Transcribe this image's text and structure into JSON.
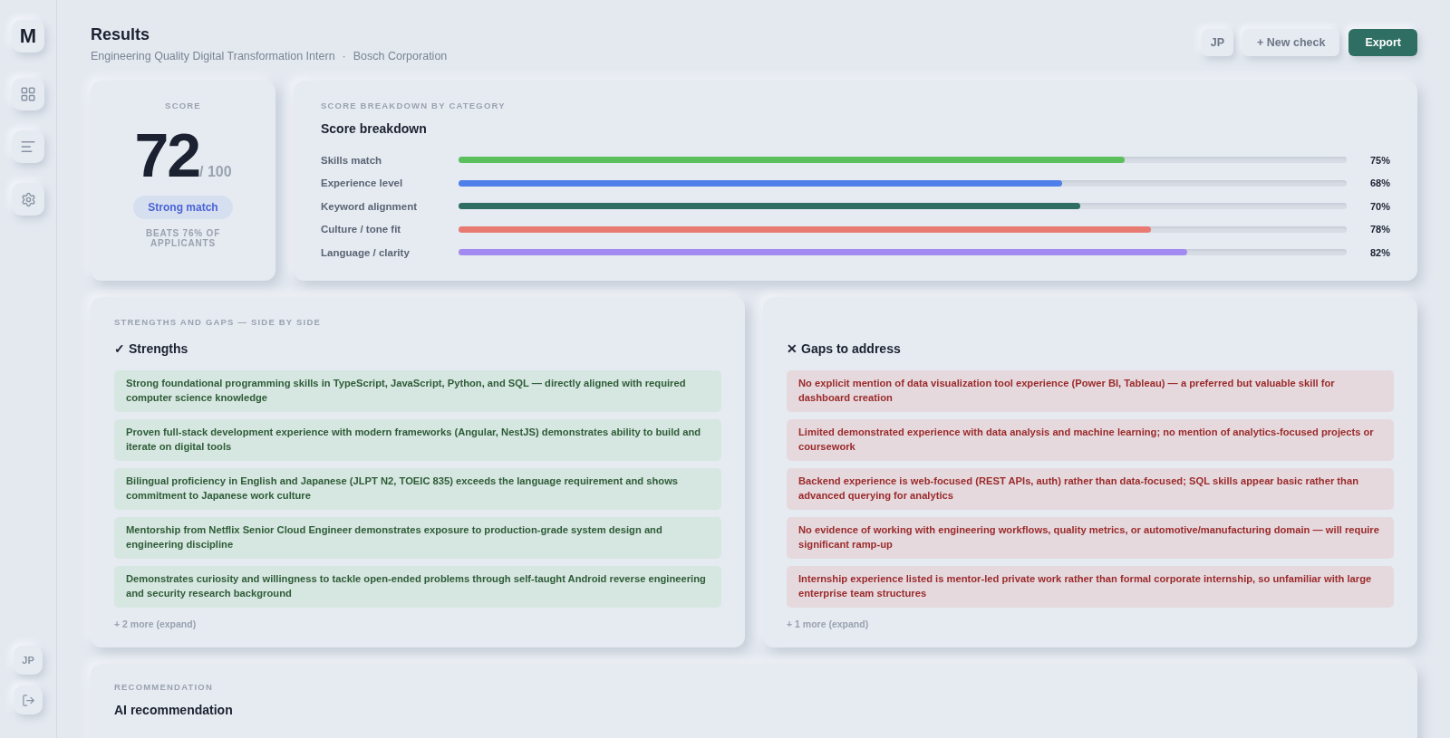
{
  "sidebar": {
    "logo": "M",
    "nav": [
      {
        "kind": "grid",
        "selected": false
      },
      {
        "kind": "list",
        "selected": false
      },
      {
        "kind": "settings",
        "selected": false
      }
    ],
    "user": "JP"
  },
  "header": {
    "title": "Results",
    "role": "Engineering Quality Digital Transformation Intern",
    "separator": "·",
    "company": "Bosch Corporation",
    "user": "JP",
    "new_button": "+ New check",
    "export_button": "Export"
  },
  "score": {
    "label": "SCORE",
    "value": "72",
    "out_of": "/ 100",
    "badge": "Strong match",
    "beats": "BEATS 76% OF APPLICANTS"
  },
  "breakdown": {
    "label": "SCORE BREAKDOWN BY CATEGORY",
    "title": "Score breakdown",
    "rows": [
      {
        "name": "Skills match",
        "level": 0.75,
        "reading": "75%",
        "color": "#5cbf5e"
      },
      {
        "name": "Experience level",
        "level": 0.68,
        "reading": "68%",
        "color": "#4f7fe8"
      },
      {
        "name": "Keyword alignment",
        "level": 0.7,
        "reading": "70%",
        "color": "#2f6e62"
      },
      {
        "name": "Culture / tone fit",
        "level": 0.78,
        "reading": "78%",
        "color": "#e97a72"
      },
      {
        "name": "Language / clarity",
        "level": 0.82,
        "reading": "82%",
        "color": "#a38af0"
      }
    ]
  },
  "strengths_gaps": {
    "label": "STRENGTHS AND GAPS — SIDE BY SIDE",
    "columns": [
      {
        "kind": "strength",
        "mark": "✓",
        "title": "Strengths",
        "items": [
          "Strong foundational programming skills in TypeScript, JavaScript, Python, and SQL — directly aligned with required computer science knowledge",
          "Proven full-stack development experience with modern frameworks (Angular, NestJS) demonstrates ability to build and iterate on digital tools",
          "Bilingual proficiency in English and Japanese (JLPT N2, TOEIC 835) exceeds the language requirement and shows commitment to Japanese work culture",
          "Mentorship from Netflix Senior Cloud Engineer demonstrates exposure to production-grade system design and engineering discipline",
          "Demonstrates curiosity and willingness to tackle open-ended problems through self-taught Android reverse engineering and security research background"
        ],
        "more": "+ 2 more (expand)"
      },
      {
        "kind": "gap",
        "mark": "✕",
        "title": "Gaps to address",
        "items": [
          "No explicit mention of data visualization tool experience (Power BI, Tableau) — a preferred but valuable skill for dashboard creation",
          "Limited demonstrated experience with data analysis and machine learning; no mention of analytics-focused projects or coursework",
          "Backend experience is web-focused (REST APIs, auth) rather than data-focused; SQL skills appear basic rather than advanced querying for analytics",
          "No evidence of working with engineering workflows, quality metrics, or automotive/manufacturing domain — will require significant ramp-up",
          "Internship experience listed is mentor-led private work rather than formal corporate internship, so unfamiliar with large enterprise team structures"
        ],
        "more": "+ 1 more (expand)"
      }
    ]
  },
  "recommendation": {
    "label": "RECOMMENDATION",
    "title": "AI recommendation"
  }
}
